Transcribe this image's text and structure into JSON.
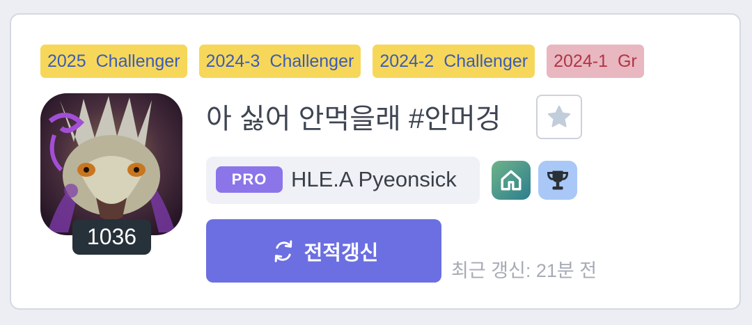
{
  "tier_history": [
    {
      "season": "2025",
      "tier": "Challenger",
      "style": "gold"
    },
    {
      "season": "2024-3",
      "tier": "Challenger",
      "style": "gold"
    },
    {
      "season": "2024-2",
      "tier": "Challenger",
      "style": "gold"
    },
    {
      "season": "2024-1",
      "tier": "Gr",
      "style": "red"
    }
  ],
  "profile": {
    "name": "아 싫어 안먹을래",
    "tag": "#안머겅",
    "level": "1036",
    "profile_icon": "avatar-dragon-creature"
  },
  "pro_badge": "PRO",
  "team_player": "HLE.A Pyeonsick",
  "icons": {
    "favorite": "star-icon",
    "home": "home-icon",
    "trophy": "trophy-icon",
    "refresh": "refresh-icon"
  },
  "renew_button": "전적갱신",
  "last_updated": "최근 갱신: 21분 전",
  "colors": {
    "tier_gold_bg": "#f6d75a",
    "tier_gold_text": "#3b5bb8",
    "tier_red_bg": "#e8b7bf",
    "tier_red_text": "#b03548",
    "pro_badge": "#8b75e9",
    "renew_button": "#6b6fe1"
  }
}
